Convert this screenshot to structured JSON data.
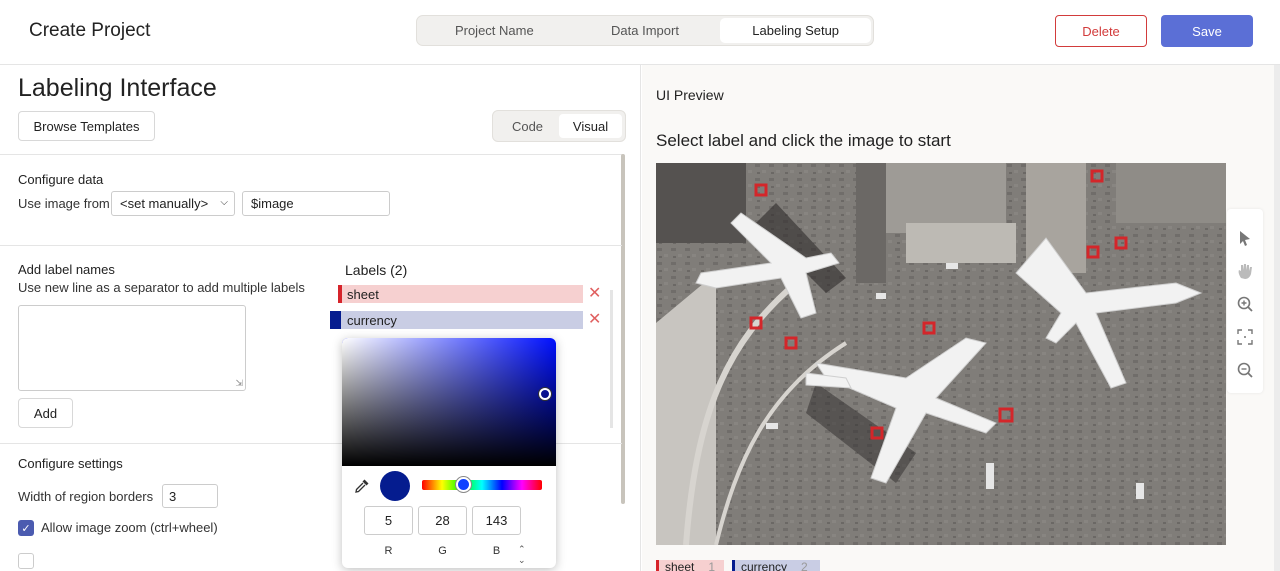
{
  "header": {
    "title": "Create Project",
    "steps": [
      "Project Name",
      "Data Import",
      "Labeling Setup"
    ],
    "active_step": "Labeling Setup",
    "delete_label": "Delete",
    "save_label": "Save"
  },
  "left": {
    "title": "Labeling Interface",
    "browse_label": "Browse Templates",
    "view_toggle": [
      "Code",
      "Visual"
    ],
    "active_view": "Visual",
    "configure_data": {
      "title": "Configure data",
      "use_image_from": "Use image from",
      "select_value": "<set manually>",
      "input_value": "$image"
    },
    "add_labels": {
      "title": "Add label names",
      "hint": "Use new line as a separator to add multiple labels",
      "textarea_value": "",
      "add_label": "Add"
    },
    "labels": {
      "title": "Labels (2)",
      "items": [
        {
          "name": "sheet",
          "color": "#d6242b",
          "bg": "#f6d0d0"
        },
        {
          "name": "currency",
          "color": "#051c8f",
          "bg": "#c9cde4"
        }
      ]
    },
    "settings": {
      "title": "Configure settings",
      "border_width_label": "Width of region borders",
      "border_width_value": "3",
      "zoom_label": "Allow image zoom (ctrl+wheel)",
      "zoom_checked": true
    },
    "color_picker": {
      "r": "5",
      "g": "28",
      "b": "143",
      "r_label": "R",
      "g_label": "G",
      "b_label": "B",
      "color": "#051c8f"
    }
  },
  "right": {
    "title": "UI Preview",
    "instruction": "Select label and click the image to start",
    "tools": [
      "pointer-icon",
      "hand-icon",
      "zoom-in-icon",
      "fit-icon",
      "zoom-out-icon"
    ],
    "region_labels": [
      {
        "name": "sheet",
        "hotkey": "1",
        "color": "#d6242b",
        "bg": "#f6d0d0"
      },
      {
        "name": "currency",
        "hotkey": "2",
        "color": "#051c8f",
        "bg": "#c9cde4"
      }
    ]
  }
}
